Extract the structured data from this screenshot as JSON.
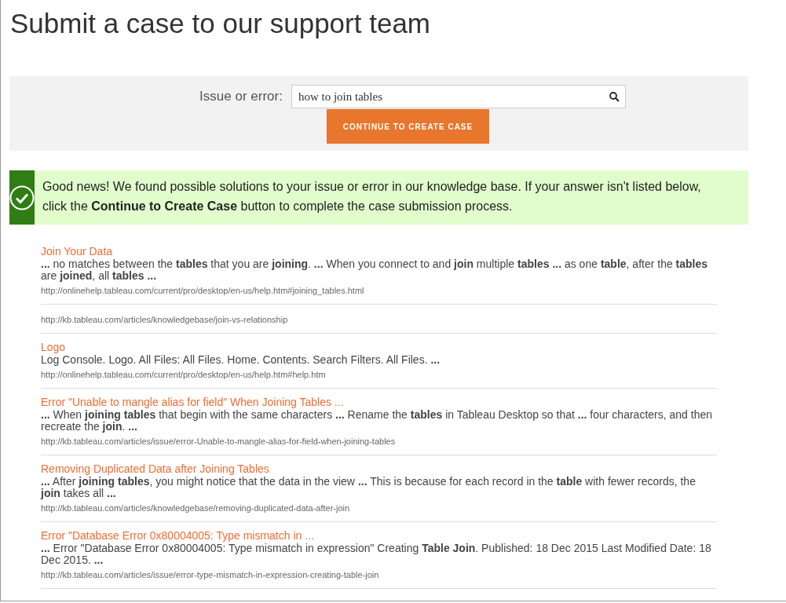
{
  "page_title": "Submit a case to our support team",
  "search": {
    "label": "Issue or error:",
    "value": "how to join tables",
    "button": "CONTINUE TO CREATE CASE"
  },
  "notice": {
    "text": "Good news! We found possible solutions to your issue or error in our knowledge base. If your answer isn't listed below, click the **Continue to Create Case** button to complete the case submission process."
  },
  "results": [
    {
      "title": "Join Your Data",
      "snippet": "**...** no matches between the **tables** that you are **joining**. **...** When you connect to and **join** multiple **tables** **...** as one **table**, after the **tables** are **joined**, all **tables** **...**",
      "url": "http://onlinehelp.tableau.com/current/pro/desktop/en-us/help.htm#joining_tables.html"
    },
    {
      "url": "http://kb.tableau.com/articles/knowledgebase/join-vs-relationship"
    },
    {
      "title": "Logo",
      "snippet": "Log Console. Logo. All Files: All Files. Home. Contents. Search Filters. All Files. **...**",
      "url": "http://onlinehelp.tableau.com/current/pro/desktop/en-us/help.htm#help.htm"
    },
    {
      "title": "Error \"Unable to mangle alias for field\" When Joining Tables ...",
      "snippet": "**...** When **joining tables** that begin with the same characters **...** Rename the **tables** in Tableau Desktop so that **...** four characters, and then recreate the **join**. **...**",
      "url": "http://kb.tableau.com/articles/issue/error-Unable-to-mangle-alias-for-field-when-joining-tables"
    },
    {
      "title": "Removing Duplicated Data after Joining Tables",
      "snippet": "**...** After **joining tables**, you might notice that the data in the view **...** This is because for each record in the **table** with fewer records, the **join** takes all **...**",
      "url": "http://kb.tableau.com/articles/knowledgebase/removing-duplicated-data-after-join"
    },
    {
      "title": "Error \"Database Error 0x80004005: Type mismatch in ...",
      "snippet": "**...** Error \"Database Error 0x80004005: Type mismatch in expression\" Creating **Table Join**. Published: 18 Dec 2015 Last Modified Date: 18 Dec 2015. **...**",
      "url": "http://kb.tableau.com/articles/issue/error-type-mismatch-in-expression-creating-table-join"
    }
  ]
}
